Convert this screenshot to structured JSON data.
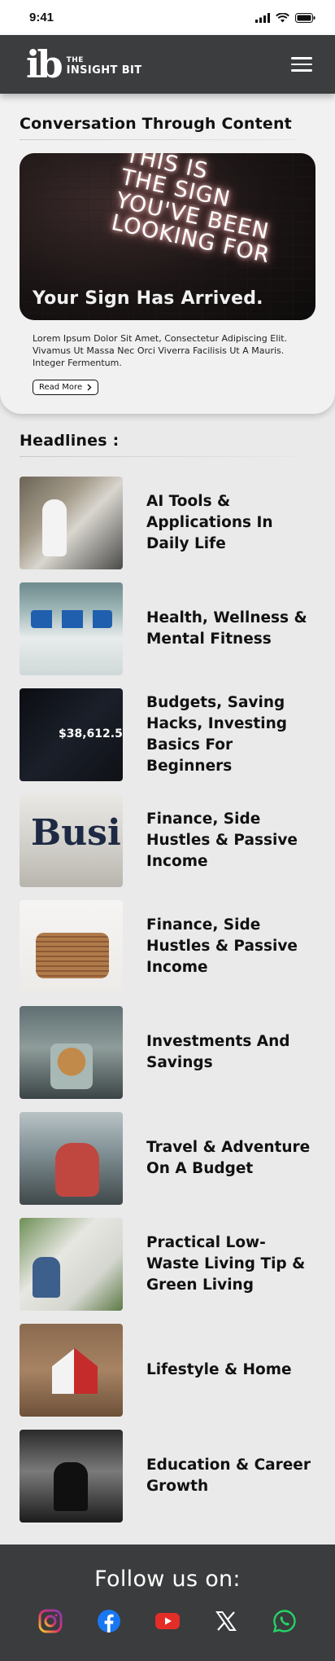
{
  "status_bar": {
    "time": "9:41"
  },
  "header": {
    "logo_mark": "ib",
    "logo_line1": "THE",
    "logo_line2": "INSIGHT BIT"
  },
  "featured": {
    "section_title": "Conversation Through Content",
    "neon_text": [
      "THIS IS",
      "THE SIGN",
      "YOU'VE BEEN",
      "LOOKING FOR"
    ],
    "image_caption": "Your Sign Has Arrived.",
    "description": "Lorem Ipsum Dolor Sit Amet, Consectetur Adipiscing Elit. Vivamus Ut Massa Nec Orci Viverra Facilisis Ut A Mauris. Integer Fermentum.",
    "read_more_label": "Read More"
  },
  "headlines": {
    "section_title": "Headlines :",
    "items": [
      {
        "title": "AI Tools & Applications In Daily Life",
        "thumb": "robot"
      },
      {
        "title": "Health, Wellness & Mental Fitness",
        "thumb": "vials"
      },
      {
        "title": "Budgets, Saving Hacks, Investing Basics For Beginners",
        "thumb": "crypto"
      },
      {
        "title": "Finance, Side Hustles & Passive Income",
        "thumb": "news"
      },
      {
        "title": "Finance, Side Hustles & Passive Income",
        "thumb": "coins"
      },
      {
        "title": "Investments And Savings",
        "thumb": "plant"
      },
      {
        "title": "Travel & Adventure On A Budget",
        "thumb": "travel"
      },
      {
        "title": "Practical Low-Waste Living Tip & Green Living",
        "thumb": "green"
      },
      {
        "title": "Lifestyle & Home",
        "thumb": "home"
      },
      {
        "title": "Education & Career Growth",
        "thumb": "edu"
      }
    ]
  },
  "footer": {
    "follow_label": "Follow us on:",
    "socials": [
      "instagram-icon",
      "facebook-icon",
      "youtube-icon",
      "x-icon",
      "whatsapp-icon"
    ]
  },
  "colors": {
    "header_bg": "#3b3d3e",
    "page_bg": "#ebeaea",
    "youtube": "#e52d27",
    "facebook": "#1877f2",
    "whatsapp": "#25d366"
  }
}
